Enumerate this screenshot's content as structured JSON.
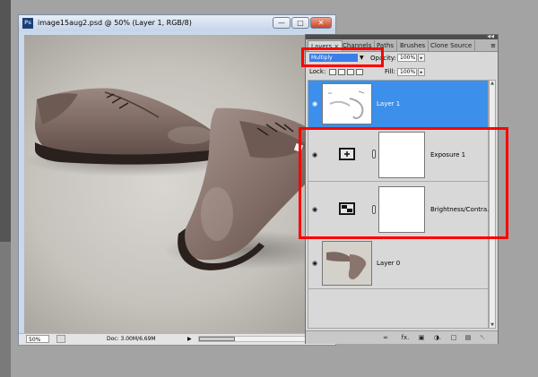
{
  "document": {
    "ps_icon_text": "Ps",
    "title": "image15aug2.psd @ 50% (Layer 1, RGB/8)",
    "window_buttons": {
      "minimize": "—",
      "maximize": "□",
      "close": "✕"
    },
    "status": {
      "zoom": "50%",
      "doc_info": "Doc: 3.00M/6.69M",
      "arrow": "▶"
    }
  },
  "layers_panel": {
    "tabs": [
      {
        "label": "Layers",
        "close": "×"
      },
      {
        "label": "Channels"
      },
      {
        "label": "Paths"
      },
      {
        "label": "Brushes"
      },
      {
        "label": "Clone Source"
      }
    ],
    "menu_icon": "≡",
    "collapse_icon": "◀◀",
    "blend_mode": "Multiply",
    "blend_arrow": "▼",
    "opacity_label": "Opacity:",
    "opacity_value": "100%",
    "stepper_arrow": "▸",
    "lock_label": "Lock:",
    "fill_label": "Fill:",
    "fill_value": "100%",
    "eye_glyph": "◉",
    "scroll_up": "▲",
    "scroll_down": "▼",
    "layers": [
      {
        "name": "Layer 1",
        "selected": true
      },
      {
        "name": "Exposure 1",
        "selected": false
      },
      {
        "name": "Brightness/Contra...",
        "selected": false
      },
      {
        "name": "Layer 0",
        "selected": false
      }
    ],
    "bottom_icons": [
      "link-layers-icon",
      "fx-icon",
      "mask-icon",
      "adjustment-icon",
      "group-icon",
      "new-layer-icon",
      "trash-icon"
    ],
    "bottom_labels": [
      "∞",
      "fx.",
      "▣",
      "◑.",
      "□",
      "▤",
      "␡"
    ]
  },
  "colors": {
    "selection_blue": "#3c8fea",
    "highlight_red": "#ff0000",
    "blend_blue": "#3a7ee8"
  }
}
